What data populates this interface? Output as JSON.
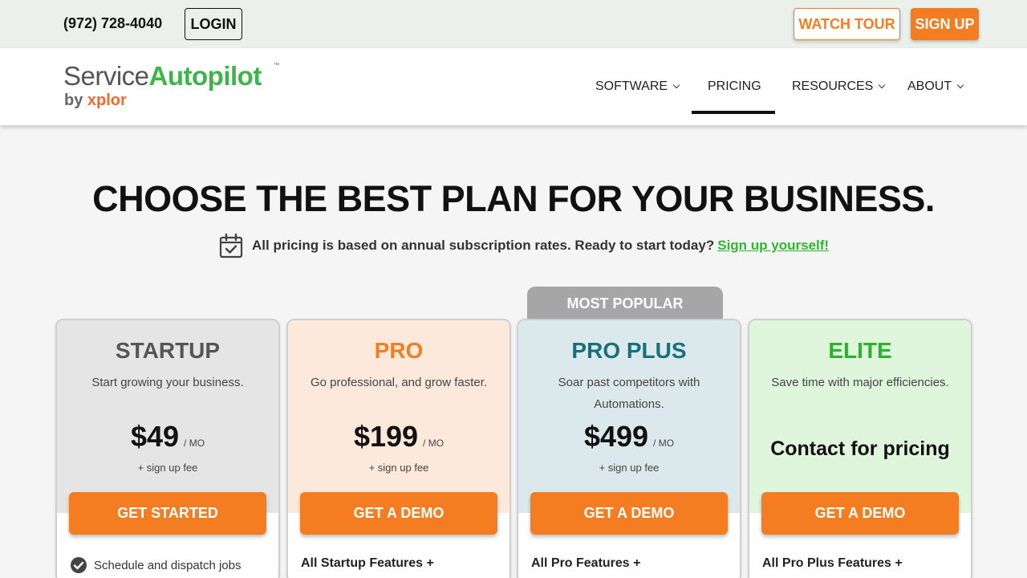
{
  "topbar": {
    "phone": "(972) 728-4040",
    "login_label": "LOGIN",
    "watch_tour_label": "WATCH TOUR",
    "sign_up_label": "SIGN UP"
  },
  "logo": {
    "service": "Service",
    "autopilot": "Autopilot",
    "tm": "™",
    "by": "by ",
    "xplor": "xplor"
  },
  "nav": {
    "items": [
      {
        "label": "SOFTWARE",
        "dropdown": true
      },
      {
        "label": "PRICING",
        "dropdown": false,
        "active": true
      },
      {
        "label": "RESOURCES",
        "dropdown": true
      },
      {
        "label": "ABOUT",
        "dropdown": true
      }
    ]
  },
  "hero": {
    "title": "CHOOSE THE BEST PLAN FOR YOUR BUSINESS.",
    "subtitle": "All pricing is based on annual subscription rates. Ready to start today?",
    "subtitle_link": "Sign up yourself!"
  },
  "popular_badge": "MOST POPULAR",
  "plans": [
    {
      "name": "STARTUP",
      "description": "Start growing your business.",
      "price": "$49",
      "period": "/ MO",
      "fee": "+ sign up fee",
      "cta": "GET STARTED",
      "feature": "Schedule and dispatch jobs",
      "name_color": "#555555",
      "bg_color": "#e5e5e5"
    },
    {
      "name": "PRO",
      "description": "Go professional, and grow faster.",
      "price": "$199",
      "period": "/ MO",
      "fee": "+ sign up fee",
      "cta": "GET A DEMO",
      "feature": "All Startup Features +",
      "name_color": "#f47d21",
      "bg_color": "#fde9dc"
    },
    {
      "name": "PRO PLUS",
      "description": "Soar past competitors with Automations.",
      "price": "$499",
      "period": "/ MO",
      "fee": "+ sign up fee",
      "cta": "GET A DEMO",
      "feature": "All Pro Features +",
      "name_color": "#17707a",
      "bg_color": "#dce9ec"
    },
    {
      "name": "ELITE",
      "description": "Save time with major efficiencies.",
      "contact": "Contact for pricing",
      "cta": "GET A DEMO",
      "feature": "All Pro Plus Features +",
      "name_color": "#28b42e",
      "bg_color": "#dff5dc"
    }
  ],
  "colors": {
    "accent_orange": "#f47d21",
    "brand_green": "#3cb54a",
    "link_green": "#2eb82e",
    "topbar_bg": "#ebf1ea"
  }
}
